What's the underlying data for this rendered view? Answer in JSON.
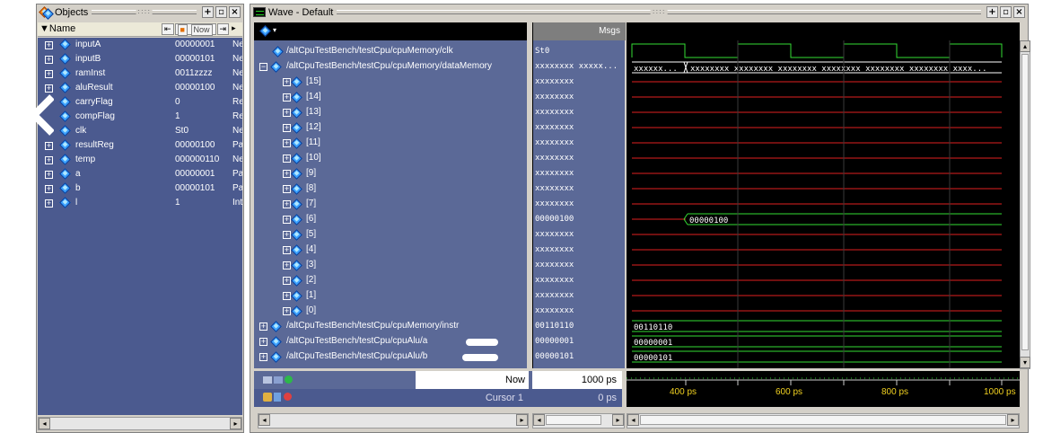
{
  "objects": {
    "title": "Objects",
    "header": {
      "name": "Name",
      "tool_now": "Now"
    },
    "items": [
      {
        "name": "inputA",
        "value": "00000001",
        "kind": "Ne"
      },
      {
        "name": "inputB",
        "value": "00000101",
        "kind": "Ne"
      },
      {
        "name": "ramInst",
        "value": "0011zzzz",
        "kind": "Ne"
      },
      {
        "name": "aluResult",
        "value": "00000100",
        "kind": "Ne"
      },
      {
        "name": "carryFlag",
        "value": "0",
        "kind": "Re"
      },
      {
        "name": "compFlag",
        "value": "1",
        "kind": "Re"
      },
      {
        "name": "clk",
        "value": "St0",
        "kind": "Ne"
      },
      {
        "name": "resultReg",
        "value": "00000100",
        "kind": "Pa"
      },
      {
        "name": "temp",
        "value": "000000110",
        "kind": "Ne"
      },
      {
        "name": "a",
        "value": "00000001",
        "kind": "Pa"
      },
      {
        "name": "b",
        "value": "00000101",
        "kind": "Pa"
      },
      {
        "name": "l",
        "value": "1",
        "kind": "Int"
      }
    ]
  },
  "wave": {
    "title": "Wave - Default",
    "msgs_header": "Msgs",
    "signals": [
      {
        "label": "/altCpuTestBench/testCpu/cpuMemory/clk",
        "msg": "St0"
      },
      {
        "label": "/altCpuTestBench/testCpu/cpuMemory/dataMemory",
        "msg": "xxxxxxxx xxxxx..."
      },
      {
        "label": "[15]",
        "msg": "xxxxxxxx"
      },
      {
        "label": "[14]",
        "msg": "xxxxxxxx"
      },
      {
        "label": "[13]",
        "msg": "xxxxxxxx"
      },
      {
        "label": "[12]",
        "msg": "xxxxxxxx"
      },
      {
        "label": "[11]",
        "msg": "xxxxxxxx"
      },
      {
        "label": "[10]",
        "msg": "xxxxxxxx"
      },
      {
        "label": "[9]",
        "msg": "xxxxxxxx"
      },
      {
        "label": "[8]",
        "msg": "xxxxxxxx"
      },
      {
        "label": "[7]",
        "msg": "xxxxxxxx"
      },
      {
        "label": "[6]",
        "msg": "00000100"
      },
      {
        "label": "[5]",
        "msg": "xxxxxxxx"
      },
      {
        "label": "[4]",
        "msg": "xxxxxxxx"
      },
      {
        "label": "[3]",
        "msg": "xxxxxxxx"
      },
      {
        "label": "[2]",
        "msg": "xxxxxxxx"
      },
      {
        "label": "[1]",
        "msg": "xxxxxxxx"
      },
      {
        "label": "[0]",
        "msg": "xxxxxxxx"
      },
      {
        "label": "/altCpuTestBench/testCpu/cpuMemory/instr",
        "msg": "00110110"
      },
      {
        "label": "/altCpuTestBench/testCpu/cpuAlu/a",
        "msg": "00000001"
      },
      {
        "label": "/altCpuTestBench/testCpu/cpuAlu/b",
        "msg": "00000101"
      }
    ],
    "wave_values": {
      "datamem_first": "xxxxxx...",
      "datamem_second": "xxxxxxxx xxxxxxxx xxxxxxxx xxxxxxxx xxxxxxxx xxxxxxxx xxxx...",
      "row6": "00000100",
      "instr": "00110110",
      "alu_a": "00000001",
      "alu_b": "00000101"
    },
    "now_label": "Now",
    "now_value": "1000 ps",
    "cursor_label": "Cursor 1",
    "cursor_value": "0 ps",
    "time_ticks": [
      "400 ps",
      "600 ps",
      "800 ps",
      "1000 ps"
    ]
  },
  "colors": {
    "objects_bg": "#4b5a8f",
    "wave_bg": "#000000",
    "signal_green": "#33dd33",
    "signal_red": "#e02020",
    "time_yellow": "#f0d020"
  }
}
